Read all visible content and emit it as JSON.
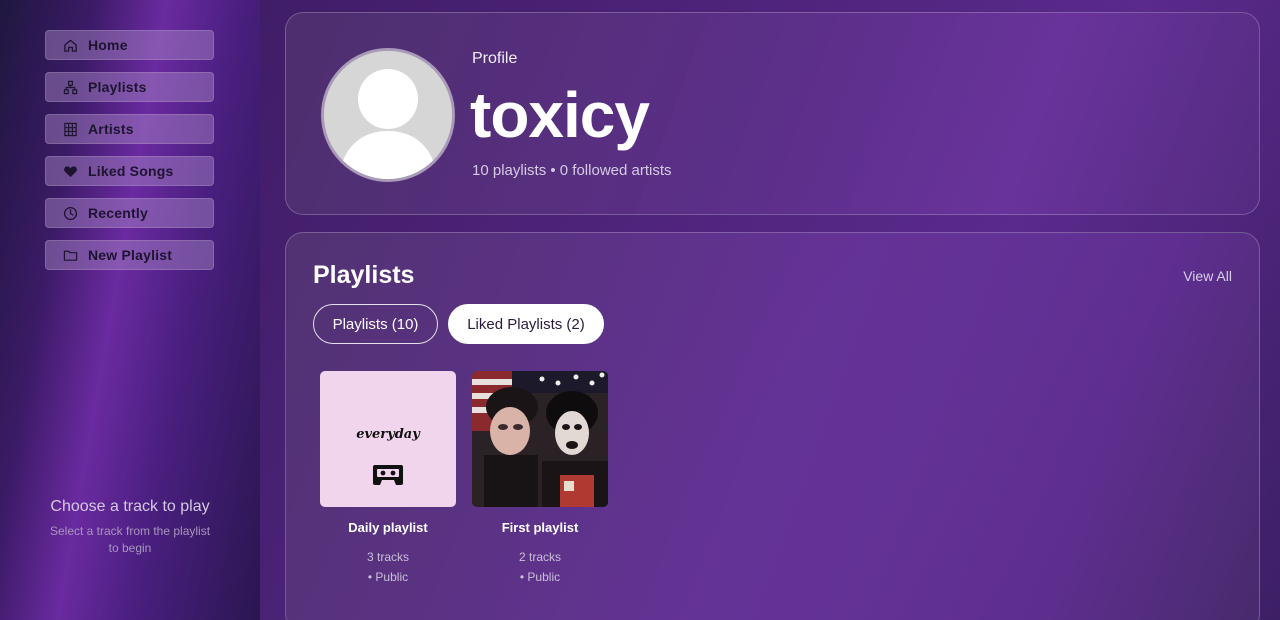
{
  "sidebar": {
    "items": [
      {
        "label": "Home",
        "icon": "home-icon"
      },
      {
        "label": "Playlists",
        "icon": "sitemap-icon"
      },
      {
        "label": "Artists",
        "icon": "grid-icon"
      },
      {
        "label": "Liked Songs",
        "icon": "heart-icon"
      },
      {
        "label": "Recently",
        "icon": "clock-icon"
      },
      {
        "label": "New Playlist",
        "icon": "folder-icon"
      }
    ],
    "player_hint": {
      "title": "Choose a track to play",
      "subtitle": "Select a track from the playlist to begin"
    }
  },
  "profile": {
    "label": "Profile",
    "name": "toxicy",
    "stats": "10 playlists • 0 followed artists"
  },
  "playlists_section": {
    "title": "Playlists",
    "view_all": "View All",
    "tabs": [
      {
        "label": "Playlists (10)",
        "active": false
      },
      {
        "label": "Liked Playlists (2)",
        "active": true
      }
    ],
    "items": [
      {
        "name": "Daily playlist",
        "tracks": "3 tracks",
        "visibility": "• Public",
        "cover_text": "everyday"
      },
      {
        "name": "First playlist",
        "tracks": "2 tracks",
        "visibility": "• Public"
      }
    ]
  },
  "colors": {
    "accent_bg": "#4b2277",
    "nav_item_bg": "#aa8cc8",
    "cover_pink": "#f0d5ec"
  }
}
